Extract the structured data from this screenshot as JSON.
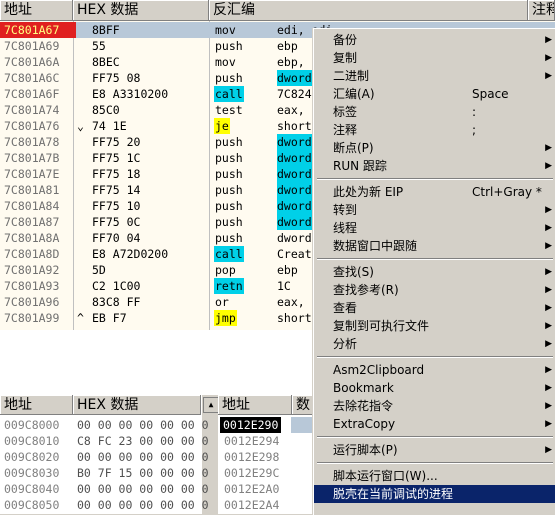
{
  "disasm": {
    "headers": [
      "地址",
      "HEX 数据",
      "反汇编",
      "注释"
    ],
    "rows": [
      {
        "addr": "7C801A67",
        "tag": "",
        "hex": "8BFF",
        "mn": "mov",
        "op": "edi, edi",
        "sel": true,
        "mcls": "",
        "ocls": ""
      },
      {
        "addr": "7C801A69",
        "tag": "",
        "hex": "55",
        "mn": "push",
        "op": "ebp",
        "mcls": "",
        "ocls": ""
      },
      {
        "addr": "7C801A6A",
        "tag": "",
        "hex": "8BEC",
        "mn": "mov",
        "op": "ebp,",
        "mcls": "",
        "ocls": ""
      },
      {
        "addr": "7C801A6C",
        "tag": "",
        "hex": "FF75 08",
        "mn": "push",
        "op": "dword",
        "mcls": "",
        "ocls": "dw"
      },
      {
        "addr": "7C801A6F",
        "tag": "",
        "hex": "E8 A3310200",
        "mn": "call",
        "op": "7C824",
        "mcls": "call",
        "ocls": ""
      },
      {
        "addr": "7C801A74",
        "tag": "",
        "hex": "85C0",
        "mn": "test",
        "op": "eax,",
        "mcls": "",
        "ocls": ""
      },
      {
        "addr": "7C801A76",
        "tag": "⌄",
        "hex": "74 1E",
        "mn": "je",
        "op": "short",
        "mcls": "je",
        "ocls": ""
      },
      {
        "addr": "7C801A78",
        "tag": "",
        "hex": "FF75 20",
        "mn": "push",
        "op": "dword",
        "mcls": "",
        "ocls": "dw"
      },
      {
        "addr": "7C801A7B",
        "tag": "",
        "hex": "FF75 1C",
        "mn": "push",
        "op": "dword",
        "mcls": "",
        "ocls": "dw"
      },
      {
        "addr": "7C801A7E",
        "tag": "",
        "hex": "FF75 18",
        "mn": "push",
        "op": "dword",
        "mcls": "",
        "ocls": "dw"
      },
      {
        "addr": "7C801A81",
        "tag": "",
        "hex": "FF75 14",
        "mn": "push",
        "op": "dword",
        "mcls": "",
        "ocls": "dw"
      },
      {
        "addr": "7C801A84",
        "tag": "",
        "hex": "FF75 10",
        "mn": "push",
        "op": "dword",
        "mcls": "",
        "ocls": "dw"
      },
      {
        "addr": "7C801A87",
        "tag": "",
        "hex": "FF75 0C",
        "mn": "push",
        "op": "dword",
        "mcls": "",
        "ocls": "dw"
      },
      {
        "addr": "7C801A8A",
        "tag": "",
        "hex": "FF70 04",
        "mn": "push",
        "op": "dword",
        "mcls": "",
        "ocls": ""
      },
      {
        "addr": "7C801A8D",
        "tag": "",
        "hex": "E8 A72D0200",
        "mn": "call",
        "op": "Creat",
        "mcls": "call",
        "ocls": ""
      },
      {
        "addr": "7C801A92",
        "tag": "",
        "hex": "5D",
        "mn": "pop",
        "op": "ebp",
        "mcls": "",
        "ocls": ""
      },
      {
        "addr": "7C801A93",
        "tag": "",
        "hex": "C2 1C00",
        "mn": "retn",
        "op": "1C",
        "mcls": "retn",
        "ocls": ""
      },
      {
        "addr": "7C801A96",
        "tag": "",
        "hex": "83C8 FF",
        "mn": "or",
        "op": "eax,",
        "mcls": "",
        "ocls": ""
      },
      {
        "addr": "7C801A99",
        "tag": "^",
        "hex": "EB F7",
        "mn": "jmp",
        "op": "short",
        "mcls": "jmp",
        "ocls": ""
      }
    ]
  },
  "dump": {
    "headers": [
      "地址",
      "HEX 数据"
    ],
    "rows": [
      {
        "addr": "009C8000",
        "hex": "00 00 00 00 00 00 0"
      },
      {
        "addr": "009C8010",
        "hex": "C8 FC 23 00 00 00 0"
      },
      {
        "addr": "009C8020",
        "hex": "00 00 00 00 00 00 0"
      },
      {
        "addr": "009C8030",
        "hex": "B0 7F 15 00 00 00 0"
      },
      {
        "addr": "009C8040",
        "hex": "00 00 00 00 00 00 0"
      },
      {
        "addr": "009C8050",
        "hex": "00 00 00 00 00 00 0"
      }
    ]
  },
  "stack": {
    "headers": [
      "地址",
      "数"
    ],
    "selected_addr": "0012E290",
    "rows": [
      "0012E294",
      "0012E298",
      "0012E29C",
      "0012E2A0",
      "0012E2A4"
    ]
  },
  "menu": {
    "items": [
      {
        "label": "备份",
        "shortcut": "",
        "arrow": true
      },
      {
        "label": "复制",
        "shortcut": "",
        "arrow": true
      },
      {
        "label": "二进制",
        "shortcut": "",
        "arrow": true
      },
      {
        "label": "汇编(A)",
        "shortcut": "Space",
        "arrow": false
      },
      {
        "label": "标签",
        "shortcut": ":",
        "arrow": false
      },
      {
        "label": "注释",
        "shortcut": ";",
        "arrow": false
      },
      {
        "label": "断点(P)",
        "shortcut": "",
        "arrow": true
      },
      {
        "label": "RUN 跟踪",
        "shortcut": "",
        "arrow": true
      },
      {
        "sep": true
      },
      {
        "label": "此处为新 EIP",
        "shortcut": "Ctrl+Gray *",
        "arrow": false
      },
      {
        "label": "转到",
        "shortcut": "",
        "arrow": true
      },
      {
        "label": "线程",
        "shortcut": "",
        "arrow": true
      },
      {
        "label": "数据窗口中跟随",
        "shortcut": "",
        "arrow": true
      },
      {
        "sep": true
      },
      {
        "label": "查找(S)",
        "shortcut": "",
        "arrow": true
      },
      {
        "label": "查找参考(R)",
        "shortcut": "",
        "arrow": true
      },
      {
        "label": "查看",
        "shortcut": "",
        "arrow": true
      },
      {
        "label": "复制到可执行文件",
        "shortcut": "",
        "arrow": true
      },
      {
        "label": "分析",
        "shortcut": "",
        "arrow": true
      },
      {
        "sep": true
      },
      {
        "label": "Asm2Clipboard",
        "shortcut": "",
        "arrow": true
      },
      {
        "label": "Bookmark",
        "shortcut": "",
        "arrow": true
      },
      {
        "label": "去除花指令",
        "shortcut": "",
        "arrow": true
      },
      {
        "label": "ExtraCopy",
        "shortcut": "",
        "arrow": true
      },
      {
        "sep": true
      },
      {
        "label": "运行脚本(P)",
        "shortcut": "",
        "arrow": true
      },
      {
        "sep": true
      },
      {
        "label": "脚本运行窗口(W)...",
        "shortcut": "",
        "arrow": false
      },
      {
        "label": "脱壳在当前调试的进程",
        "shortcut": "",
        "arrow": false,
        "highlighted": true
      }
    ]
  },
  "colors": {
    "selected_address_bg": "#e02020",
    "call_highlight": "#00d0e8",
    "jump_highlight": "#ffff00",
    "menu_highlight": "#0a246a"
  }
}
